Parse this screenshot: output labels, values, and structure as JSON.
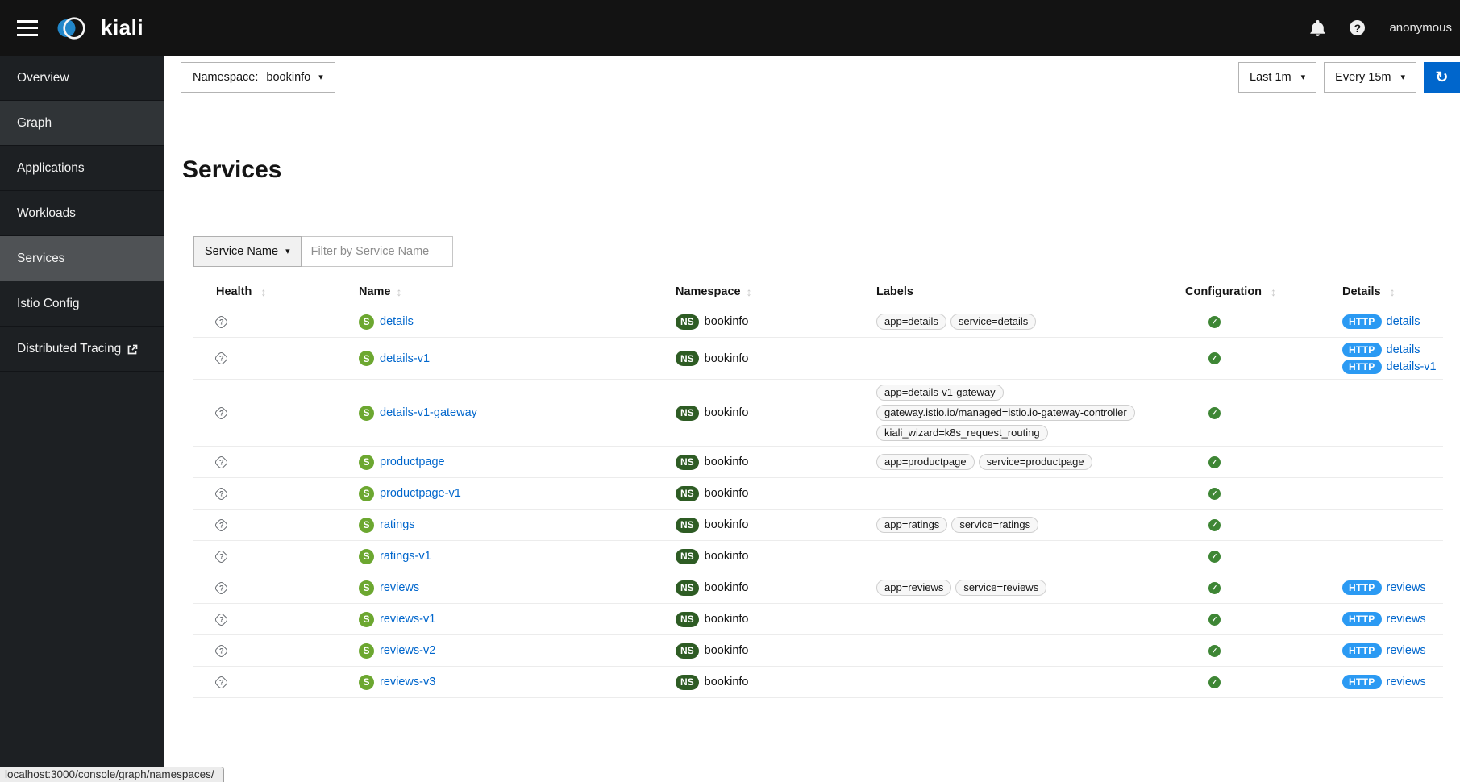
{
  "topbar": {
    "brand": "kiali",
    "user": "anonymous"
  },
  "icons": {
    "caret_down": "▾",
    "sort": "↕",
    "refresh": "↻",
    "help": "?",
    "health_unknown": "?",
    "config_valid": "✓"
  },
  "badges": {
    "service": "S",
    "namespace": "NS"
  },
  "sidebar": {
    "items": [
      {
        "label": "Overview",
        "state": "normal",
        "external": false
      },
      {
        "label": "Graph",
        "state": "hover",
        "external": false
      },
      {
        "label": "Applications",
        "state": "normal",
        "external": false
      },
      {
        "label": "Workloads",
        "state": "normal",
        "external": false
      },
      {
        "label": "Services",
        "state": "selected",
        "external": false
      },
      {
        "label": "Istio Config",
        "state": "normal",
        "external": false
      },
      {
        "label": "Distributed Tracing",
        "state": "normal",
        "external": true
      }
    ]
  },
  "toolbar": {
    "namespace_label": "Namespace:",
    "namespace_value": "bookinfo",
    "duration": "Last 1m",
    "refresh_interval": "Every 15m"
  },
  "page": {
    "title": "Services"
  },
  "filter": {
    "type_label": "Service Name",
    "placeholder": "Filter by Service Name"
  },
  "table": {
    "columns": [
      {
        "label": "Health",
        "sortable": true
      },
      {
        "label": "Name",
        "sortable": true
      },
      {
        "label": "Namespace",
        "sortable": true
      },
      {
        "label": "Labels",
        "sortable": false
      },
      {
        "label": "Configuration",
        "sortable": true
      },
      {
        "label": "Details",
        "sortable": true
      }
    ],
    "rows": [
      {
        "health": "unknown",
        "name": "details",
        "namespace": "bookinfo",
        "labels": [
          "app=details",
          "service=details"
        ],
        "config": "valid",
        "details": [
          {
            "protocol": "HTTP",
            "link": "details"
          }
        ]
      },
      {
        "health": "unknown",
        "name": "details-v1",
        "namespace": "bookinfo",
        "labels": [],
        "config": "valid",
        "details": [
          {
            "protocol": "HTTP",
            "link": "details"
          },
          {
            "protocol": "HTTP",
            "link": "details-v1"
          }
        ]
      },
      {
        "health": "unknown",
        "name": "details-v1-gateway",
        "namespace": "bookinfo",
        "labels": [
          "app=details-v1-gateway",
          "gateway.istio.io/managed=istio.io-gateway-controller",
          "kiali_wizard=k8s_request_routing"
        ],
        "config": "valid",
        "details": []
      },
      {
        "health": "unknown",
        "name": "productpage",
        "namespace": "bookinfo",
        "labels": [
          "app=productpage",
          "service=productpage"
        ],
        "config": "valid",
        "details": []
      },
      {
        "health": "unknown",
        "name": "productpage-v1",
        "namespace": "bookinfo",
        "labels": [],
        "config": "valid",
        "details": []
      },
      {
        "health": "unknown",
        "name": "ratings",
        "namespace": "bookinfo",
        "labels": [
          "app=ratings",
          "service=ratings"
        ],
        "config": "valid",
        "details": []
      },
      {
        "health": "unknown",
        "name": "ratings-v1",
        "namespace": "bookinfo",
        "labels": [],
        "config": "valid",
        "details": []
      },
      {
        "health": "unknown",
        "name": "reviews",
        "namespace": "bookinfo",
        "labels": [
          "app=reviews",
          "service=reviews"
        ],
        "config": "valid",
        "details": [
          {
            "protocol": "HTTP",
            "link": "reviews"
          }
        ]
      },
      {
        "health": "unknown",
        "name": "reviews-v1",
        "namespace": "bookinfo",
        "labels": [],
        "config": "valid",
        "details": [
          {
            "protocol": "HTTP",
            "link": "reviews"
          }
        ]
      },
      {
        "health": "unknown",
        "name": "reviews-v2",
        "namespace": "bookinfo",
        "labels": [],
        "config": "valid",
        "details": [
          {
            "protocol": "HTTP",
            "link": "reviews"
          }
        ]
      },
      {
        "health": "unknown",
        "name": "reviews-v3",
        "namespace": "bookinfo",
        "labels": [],
        "config": "valid",
        "details": [
          {
            "protocol": "HTTP",
            "link": "reviews"
          }
        ]
      }
    ]
  },
  "statusbar": {
    "url": "localhost:3000/console/graph/namespaces/"
  },
  "colors": {
    "accent_blue": "#0066CC",
    "http_badge_blue": "#2B9AF3",
    "service_badge_green": "#6CA730",
    "namespace_badge_green": "#2E5C24",
    "config_valid_green": "#3E8635",
    "health_unknown_gray": "#6A6E73"
  }
}
